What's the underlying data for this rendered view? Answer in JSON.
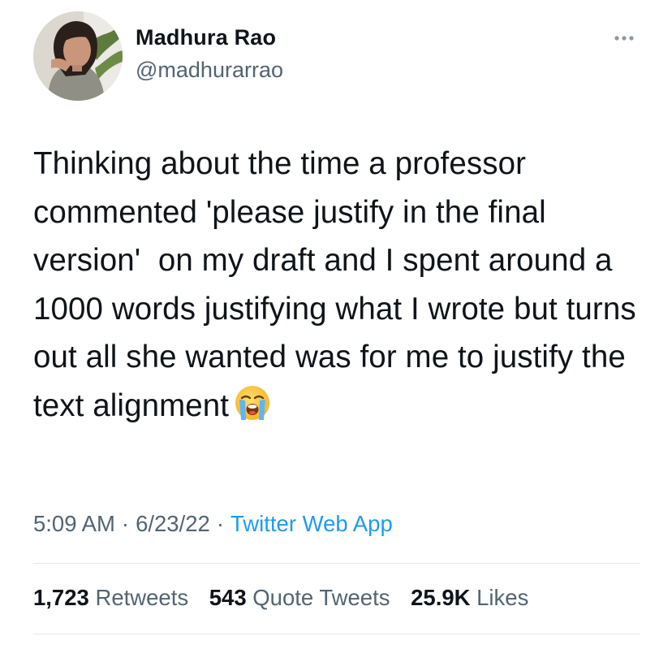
{
  "author": {
    "display_name": "Madhura Rao",
    "handle": "@madhurarrao"
  },
  "icons": {
    "more": "more-horizontal-icon",
    "emoji": "loudly-crying-face-emoji"
  },
  "tweet": {
    "text": "Thinking about the time a professor commented 'please justify in the final version'  on my draft and I spent around a 1000 words justifying what I wrote but turns out all she wanted was for me to justify the text alignment",
    "time": "5:09 AM",
    "separator": "·",
    "date": "6/23/22",
    "source": "Twitter Web App"
  },
  "stats": {
    "retweets_count": "1,723",
    "retweets_label": "Retweets",
    "quotes_count": "543",
    "quotes_label": "Quote Tweets",
    "likes_count": "25.9K",
    "likes_label": "Likes"
  },
  "colors": {
    "text": "#0f1419",
    "secondary": "#536471",
    "link": "#1d9bf0",
    "divider": "#e4e8eb"
  }
}
